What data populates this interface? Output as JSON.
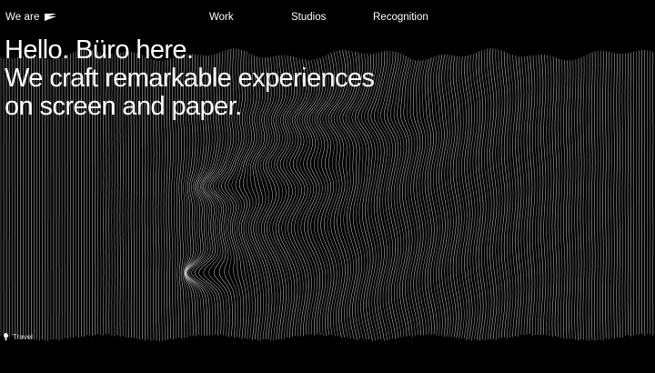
{
  "header": {
    "brand_label": "We are",
    "brand_icon": "flag-logo-icon",
    "nav": {
      "work": "Work",
      "studios": "Studios",
      "recognition": "Recognition"
    }
  },
  "hero": {
    "line1": "Hello. Büro here.",
    "line2": "We craft remarkable experiences",
    "line3": "on screen and paper."
  },
  "footer": {
    "tag_label": "Travel",
    "tag_icon": "lightbulb-icon"
  },
  "colors": {
    "background": "#000000",
    "text": "#ffffff",
    "lines": "#ffffff"
  }
}
